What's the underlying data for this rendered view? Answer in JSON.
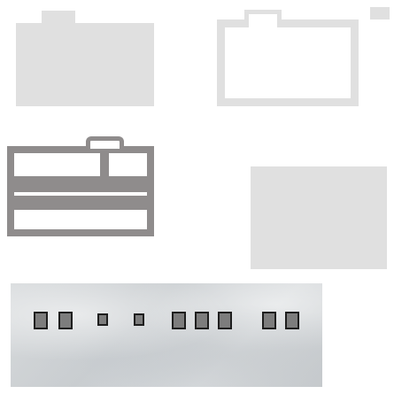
{
  "palette": {
    "light_gray": "#e0e0e0",
    "dark_gray": "#8f8c8c",
    "block_fill": "#7d7d7d",
    "block_border": "#1e1e1e",
    "background": "#ffffff"
  },
  "icons": [
    "folder-solid-icon",
    "folder-outline-icon",
    "folder-open-icon"
  ],
  "strip": {
    "block_groups": [
      2,
      1,
      1,
      3,
      2
    ]
  }
}
